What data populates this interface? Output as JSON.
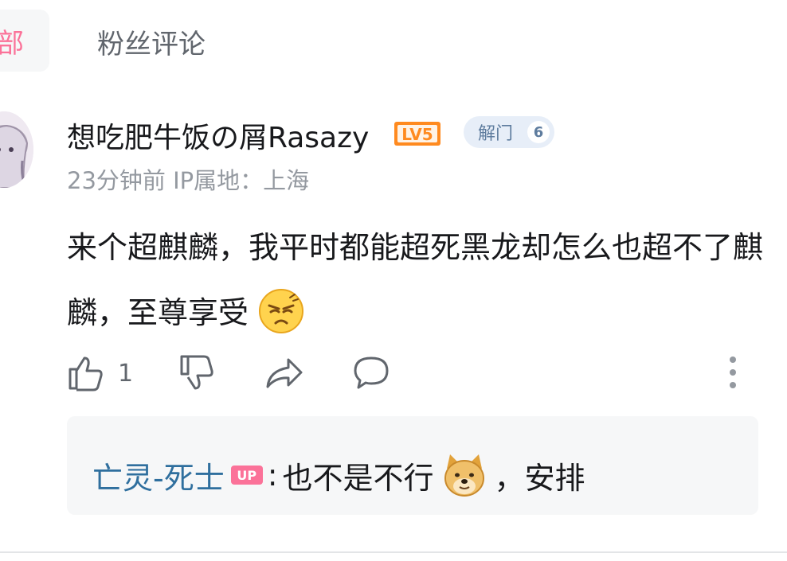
{
  "tabs": {
    "all_partial": "部",
    "fans": "粉丝评论"
  },
  "comment": {
    "username": "想吃肥牛饭の屑Rasazy",
    "level_badge": "LV5",
    "fan_badge": {
      "name": "解门",
      "level": "6"
    },
    "time": "23分钟前",
    "ip_location": "IP属地：上海",
    "text": "来个超麒麟，我平时都能超死黑龙却怎么也超不了麒麟，至尊享受",
    "text_emoji": "annoyed-face-emoji",
    "like_count": "1"
  },
  "reply": {
    "user": "亡灵-死士",
    "up_badge": "UP",
    "separator": ":",
    "text_before": "也不是不行",
    "emoji": "doge-emoji",
    "text_after": "，安排"
  },
  "colors": {
    "accent_pink": "#fb7299",
    "reply_user": "#2f6f9e",
    "level_orange": "#ff8a1f"
  }
}
